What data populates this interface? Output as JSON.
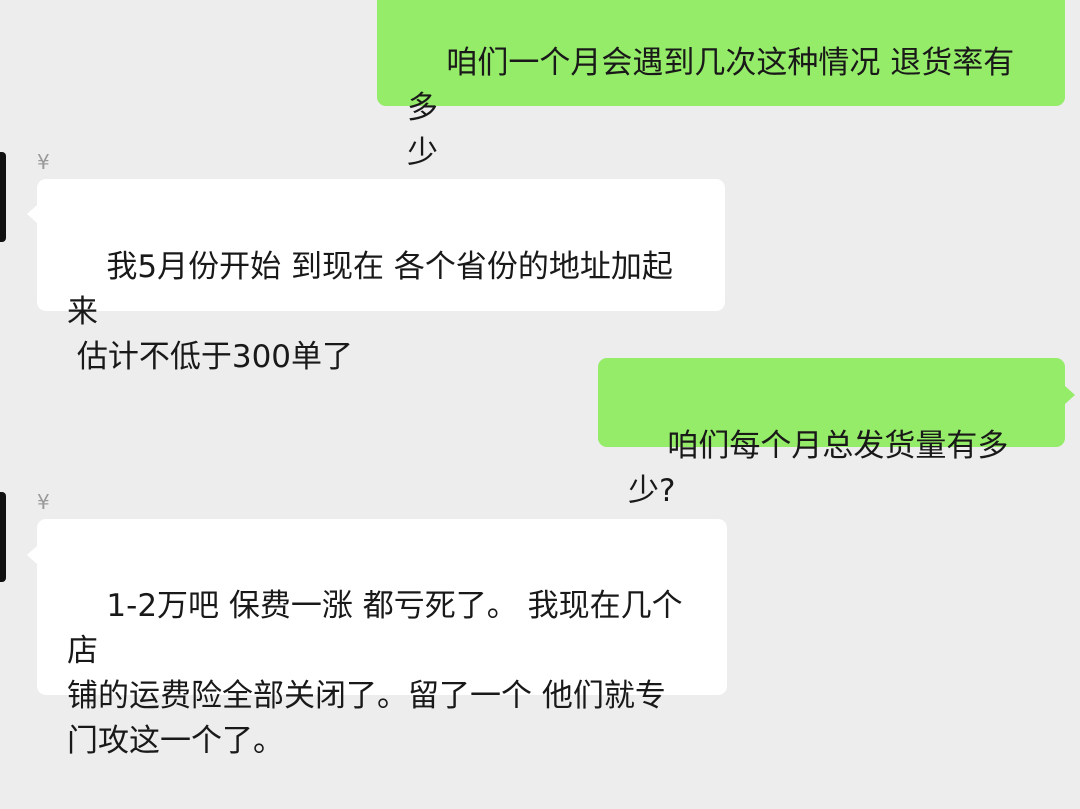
{
  "colors": {
    "background": "#ededed",
    "outgoing_bubble": "#95ec69",
    "incoming_bubble": "#ffffff",
    "sender_name": "#9a9a9a",
    "text": "#191919"
  },
  "messages": [
    {
      "direction": "outgoing",
      "text": "咱们一个月会遇到几次这种情况 退货率有多\n少"
    },
    {
      "direction": "incoming",
      "sender": "¥",
      "text": "我5月份开始 到现在 各个省份的地址加起来\n 估计不低于300单了"
    },
    {
      "direction": "outgoing",
      "text": "咱们每个月总发货量有多少?"
    },
    {
      "direction": "incoming",
      "sender": "¥",
      "text": "1-2万吧 保费一涨 都亏死了。 我现在几个店\n铺的运费险全部关闭了。留了一个 他们就专\n门攻这一个了。"
    }
  ]
}
